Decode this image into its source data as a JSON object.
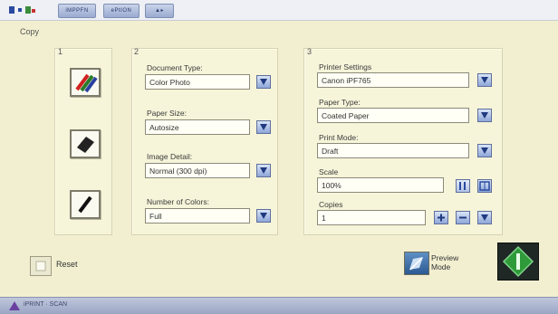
{
  "toolbar": {
    "tabs": [
      "iMPPFN",
      "ePtION",
      "▲▸"
    ]
  },
  "copy_label": "Copy",
  "panels": {
    "p1": {
      "number": "1"
    },
    "p2": {
      "number": "2"
    },
    "p3": {
      "number": "3"
    }
  },
  "document_type": {
    "label": "Document Type:",
    "value": "Color Photo"
  },
  "paper_size": {
    "label": "Paper Size:",
    "value": "Autosize"
  },
  "image_detail": {
    "label": "Image Detail:",
    "value": "Normal (300 dpi)"
  },
  "number_of_colors": {
    "label": "Number of Colors:",
    "value": "Full"
  },
  "printer_settings": {
    "label": "Printer Settings",
    "value": "Canon iPF765"
  },
  "paper_type": {
    "label": "Paper Type:",
    "value": "Coated Paper"
  },
  "print_mode": {
    "label": "Print Mode:",
    "value": "Draft"
  },
  "scale": {
    "label": "Scale",
    "value": "100%"
  },
  "copies": {
    "label": "Copies",
    "value": "1"
  },
  "actions": {
    "reset": "Reset",
    "preview": "Preview Mode"
  },
  "status": {
    "text": "iPRINT · SCAN"
  },
  "colors": {
    "background": "#f1efd0",
    "accent_blue": "#2c5a93",
    "start_green": "#2f9a3a"
  }
}
